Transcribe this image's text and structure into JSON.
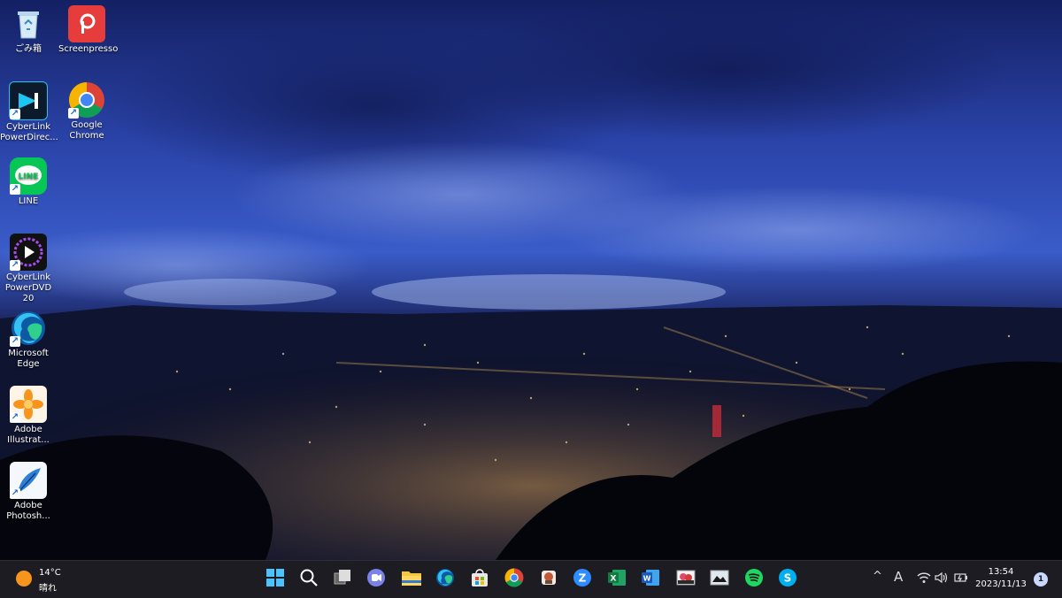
{
  "desktop": {
    "icons": [
      {
        "label": "ごみ箱"
      },
      {
        "label": "Screenpresso"
      },
      {
        "label": "CyberLink PowerDirec..."
      },
      {
        "label": "Google Chrome"
      },
      {
        "label": "LINE"
      },
      {
        "label": "CyberLink PowerDVD 20"
      },
      {
        "label": "Microsoft Edge"
      },
      {
        "label": "Adobe Illustrat..."
      },
      {
        "label": "Adobe Photosh..."
      }
    ]
  },
  "taskbar": {
    "weather": {
      "temp": "14°C",
      "condition": "晴れ",
      "icon": "sun-icon"
    },
    "apps": [
      {
        "name": "start-icon"
      },
      {
        "name": "search-icon"
      },
      {
        "name": "task-view-icon"
      },
      {
        "name": "teams-chat-icon"
      },
      {
        "name": "file-explorer-icon"
      },
      {
        "name": "edge-icon"
      },
      {
        "name": "store-icon"
      },
      {
        "name": "chrome-icon"
      },
      {
        "name": "app-icon"
      },
      {
        "name": "zoom-icon"
      },
      {
        "name": "excel-icon"
      },
      {
        "name": "word-icon"
      },
      {
        "name": "image-app-icon"
      },
      {
        "name": "photo-app-icon"
      },
      {
        "name": "spotify-icon"
      },
      {
        "name": "skype-icon"
      }
    ],
    "tray": {
      "chevron": "^",
      "ime": "A",
      "clock_time": "13:54",
      "clock_date": "2023/11/13",
      "notification_count": "1"
    }
  },
  "colors": {
    "taskbar_bg": "#1c1c22",
    "sky_top": "#1a2a6c",
    "sky_mid": "#3a5bc7",
    "city_dark": "#0a0d1c"
  }
}
